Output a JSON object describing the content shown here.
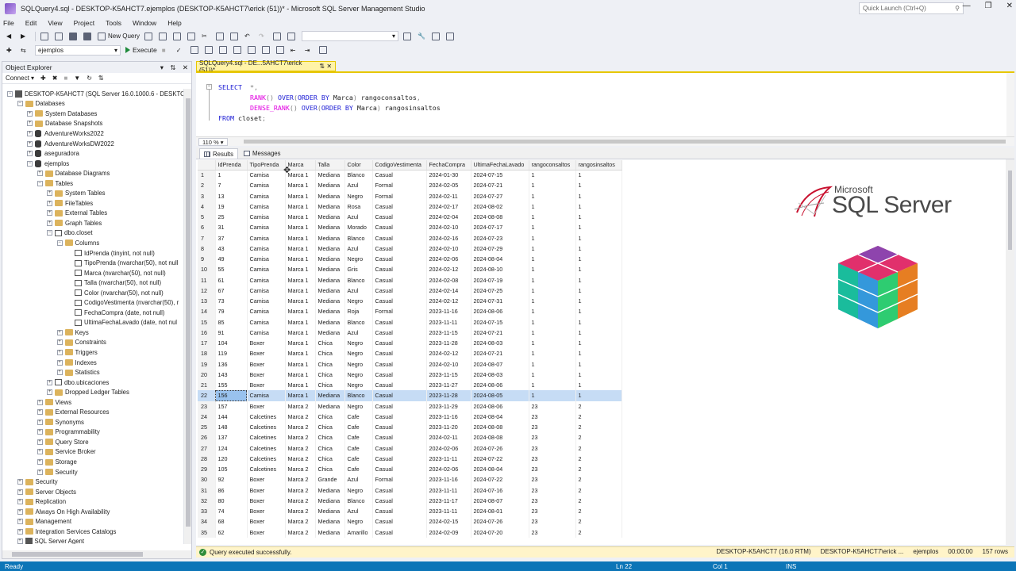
{
  "window": {
    "title": "SQLQuery4.sql - DESKTOP-K5AHCT7.ejemplos (DESKTOP-K5AHCT7\\erick (51))* - Microsoft SQL Server Management Studio",
    "quick_launch_placeholder": "Quick Launch (Ctrl+Q)"
  },
  "menu": [
    "File",
    "Edit",
    "View",
    "Project",
    "Tools",
    "Window",
    "Help"
  ],
  "toolbar": {
    "new_query_label": "New Query",
    "database_selected": "ejemplos",
    "execute_label": "Execute"
  },
  "object_explorer": {
    "title": "Object Explorer",
    "connect_label": "Connect",
    "tree": [
      {
        "depth": 0,
        "exp": "-",
        "icon": "server",
        "label": "DESKTOP-K5AHCT7 (SQL Server 16.0.1000.6 - DESKTOP-"
      },
      {
        "depth": 1,
        "exp": "-",
        "icon": "folder",
        "label": "Databases"
      },
      {
        "depth": 2,
        "exp": "+",
        "icon": "folder",
        "label": "System Databases"
      },
      {
        "depth": 2,
        "exp": "+",
        "icon": "folder",
        "label": "Database Snapshots"
      },
      {
        "depth": 2,
        "exp": "+",
        "icon": "db",
        "label": "AdventureWorks2022"
      },
      {
        "depth": 2,
        "exp": "+",
        "icon": "db",
        "label": "AdventureWorksDW2022"
      },
      {
        "depth": 2,
        "exp": "+",
        "icon": "db",
        "label": "aseguradora"
      },
      {
        "depth": 2,
        "exp": "-",
        "icon": "db",
        "label": "ejemplos"
      },
      {
        "depth": 3,
        "exp": "+",
        "icon": "folder",
        "label": "Database Diagrams"
      },
      {
        "depth": 3,
        "exp": "-",
        "icon": "folder",
        "label": "Tables"
      },
      {
        "depth": 4,
        "exp": "+",
        "icon": "folder",
        "label": "System Tables"
      },
      {
        "depth": 4,
        "exp": "+",
        "icon": "folder",
        "label": "FileTables"
      },
      {
        "depth": 4,
        "exp": "+",
        "icon": "folder",
        "label": "External Tables"
      },
      {
        "depth": 4,
        "exp": "+",
        "icon": "folder",
        "label": "Graph Tables"
      },
      {
        "depth": 4,
        "exp": "-",
        "icon": "table",
        "label": "dbo.closet"
      },
      {
        "depth": 5,
        "exp": "-",
        "icon": "folder",
        "label": "Columns"
      },
      {
        "depth": 6,
        "exp": "",
        "icon": "column",
        "label": "IdPrenda (tinyint, not null)"
      },
      {
        "depth": 6,
        "exp": "",
        "icon": "column",
        "label": "TipoPrenda (nvarchar(50), not null"
      },
      {
        "depth": 6,
        "exp": "",
        "icon": "column",
        "label": "Marca (nvarchar(50), not null)"
      },
      {
        "depth": 6,
        "exp": "",
        "icon": "column",
        "label": "Talla (nvarchar(50), not null)"
      },
      {
        "depth": 6,
        "exp": "",
        "icon": "column",
        "label": "Color (nvarchar(50), not null)"
      },
      {
        "depth": 6,
        "exp": "",
        "icon": "column",
        "label": "CodigoVestimenta (nvarchar(50), r"
      },
      {
        "depth": 6,
        "exp": "",
        "icon": "column",
        "label": "FechaCompra (date, not null)"
      },
      {
        "depth": 6,
        "exp": "",
        "icon": "column",
        "label": "UltimaFechaLavado (date, not nul"
      },
      {
        "depth": 5,
        "exp": "+",
        "icon": "folder",
        "label": "Keys"
      },
      {
        "depth": 5,
        "exp": "+",
        "icon": "folder",
        "label": "Constraints"
      },
      {
        "depth": 5,
        "exp": "+",
        "icon": "folder",
        "label": "Triggers"
      },
      {
        "depth": 5,
        "exp": "+",
        "icon": "folder",
        "label": "Indexes"
      },
      {
        "depth": 5,
        "exp": "+",
        "icon": "folder",
        "label": "Statistics"
      },
      {
        "depth": 4,
        "exp": "+",
        "icon": "table",
        "label": "dbo.ubicaciones"
      },
      {
        "depth": 4,
        "exp": "+",
        "icon": "folder",
        "label": "Dropped Ledger Tables"
      },
      {
        "depth": 3,
        "exp": "+",
        "icon": "folder",
        "label": "Views"
      },
      {
        "depth": 3,
        "exp": "+",
        "icon": "folder",
        "label": "External Resources"
      },
      {
        "depth": 3,
        "exp": "+",
        "icon": "folder",
        "label": "Synonyms"
      },
      {
        "depth": 3,
        "exp": "+",
        "icon": "folder",
        "label": "Programmability"
      },
      {
        "depth": 3,
        "exp": "+",
        "icon": "folder",
        "label": "Query Store"
      },
      {
        "depth": 3,
        "exp": "+",
        "icon": "folder",
        "label": "Service Broker"
      },
      {
        "depth": 3,
        "exp": "+",
        "icon": "folder",
        "label": "Storage"
      },
      {
        "depth": 3,
        "exp": "+",
        "icon": "folder",
        "label": "Security"
      },
      {
        "depth": 1,
        "exp": "+",
        "icon": "folder",
        "label": "Security"
      },
      {
        "depth": 1,
        "exp": "+",
        "icon": "folder",
        "label": "Server Objects"
      },
      {
        "depth": 1,
        "exp": "+",
        "icon": "folder",
        "label": "Replication"
      },
      {
        "depth": 1,
        "exp": "+",
        "icon": "folder",
        "label": "Always On High Availability"
      },
      {
        "depth": 1,
        "exp": "+",
        "icon": "folder",
        "label": "Management"
      },
      {
        "depth": 1,
        "exp": "+",
        "icon": "folder",
        "label": "Integration Services Catalogs"
      },
      {
        "depth": 1,
        "exp": "+",
        "icon": "server",
        "label": "SQL Server Agent"
      }
    ]
  },
  "editor": {
    "tab_label": "SQLQuery4.sql - DE...5AHCT7\\erick (51))*",
    "code": [
      {
        "parts": [
          [
            "kw",
            "SELECT"
          ],
          [
            "gr",
            "  *,"
          ]
        ]
      },
      {
        "parts": [
          [
            "fn",
            "        RANK"
          ],
          [
            "gr",
            "()"
          ],
          [
            "kw",
            " OVER"
          ],
          [
            "gr",
            "("
          ],
          [
            "kw",
            "ORDER BY"
          ],
          [
            "",
            " Marca"
          ],
          [
            "gr",
            ")"
          ],
          [
            "",
            " rangoconsaltos"
          ],
          [
            "gr",
            ","
          ]
        ]
      },
      {
        "parts": [
          [
            "fn",
            "        DENSE_RANK"
          ],
          [
            "gr",
            "()"
          ],
          [
            "kw",
            " OVER"
          ],
          [
            "gr",
            "("
          ],
          [
            "kw",
            "ORDER BY"
          ],
          [
            "",
            " Marca"
          ],
          [
            "gr",
            ")"
          ],
          [
            "",
            " rangosinsaltos"
          ]
        ]
      },
      {
        "parts": [
          [
            "kw",
            "FROM"
          ],
          [
            "",
            " closet"
          ],
          [
            "gr",
            ";"
          ]
        ]
      }
    ],
    "zoom": "110 %"
  },
  "results": {
    "tabs": [
      "Results",
      "Messages"
    ],
    "columns": [
      "IdPrenda",
      "TipoPrenda",
      "Marca",
      "Talla",
      "Color",
      "CodigoVestimenta",
      "FechaCompra",
      "UltimaFechaLavado",
      "rangoconsaltos",
      "rangosinsaltos"
    ],
    "selected_row": 22,
    "rows": [
      [
        "1",
        "1",
        "Camisa",
        "Marca 1",
        "Mediana",
        "Blanco",
        "Casual",
        "2024-01-30",
        "2024-07-15",
        "1",
        "1"
      ],
      [
        "2",
        "7",
        "Camisa",
        "Marca 1",
        "Mediana",
        "Azul",
        "Formal",
        "2024-02-05",
        "2024-07-21",
        "1",
        "1"
      ],
      [
        "3",
        "13",
        "Camisa",
        "Marca 1",
        "Mediana",
        "Negro",
        "Formal",
        "2024-02-11",
        "2024-07-27",
        "1",
        "1"
      ],
      [
        "4",
        "19",
        "Camisa",
        "Marca 1",
        "Mediana",
        "Rosa",
        "Casual",
        "2024-02-17",
        "2024-08-02",
        "1",
        "1"
      ],
      [
        "5",
        "25",
        "Camisa",
        "Marca 1",
        "Mediana",
        "Azul",
        "Casual",
        "2024-02-04",
        "2024-08-08",
        "1",
        "1"
      ],
      [
        "6",
        "31",
        "Camisa",
        "Marca 1",
        "Mediana",
        "Morado",
        "Casual",
        "2024-02-10",
        "2024-07-17",
        "1",
        "1"
      ],
      [
        "7",
        "37",
        "Camisa",
        "Marca 1",
        "Mediana",
        "Blanco",
        "Casual",
        "2024-02-16",
        "2024-07-23",
        "1",
        "1"
      ],
      [
        "8",
        "43",
        "Camisa",
        "Marca 1",
        "Mediana",
        "Azul",
        "Casual",
        "2024-02-10",
        "2024-07-29",
        "1",
        "1"
      ],
      [
        "9",
        "49",
        "Camisa",
        "Marca 1",
        "Mediana",
        "Negro",
        "Casual",
        "2024-02-06",
        "2024-08-04",
        "1",
        "1"
      ],
      [
        "10",
        "55",
        "Camisa",
        "Marca 1",
        "Mediana",
        "Gris",
        "Casual",
        "2024-02-12",
        "2024-08-10",
        "1",
        "1"
      ],
      [
        "11",
        "61",
        "Camisa",
        "Marca 1",
        "Mediana",
        "Blanco",
        "Casual",
        "2024-02-08",
        "2024-07-19",
        "1",
        "1"
      ],
      [
        "12",
        "67",
        "Camisa",
        "Marca 1",
        "Mediana",
        "Azul",
        "Casual",
        "2024-02-14",
        "2024-07-25",
        "1",
        "1"
      ],
      [
        "13",
        "73",
        "Camisa",
        "Marca 1",
        "Mediana",
        "Negro",
        "Casual",
        "2024-02-12",
        "2024-07-31",
        "1",
        "1"
      ],
      [
        "14",
        "79",
        "Camisa",
        "Marca 1",
        "Mediana",
        "Roja",
        "Formal",
        "2023-11-16",
        "2024-08-06",
        "1",
        "1"
      ],
      [
        "15",
        "85",
        "Camisa",
        "Marca 1",
        "Mediana",
        "Blanco",
        "Casual",
        "2023-11-11",
        "2024-07-15",
        "1",
        "1"
      ],
      [
        "16",
        "91",
        "Camisa",
        "Marca 1",
        "Mediana",
        "Azul",
        "Casual",
        "2023-11-15",
        "2024-07-21",
        "1",
        "1"
      ],
      [
        "17",
        "104",
        "Boxer",
        "Marca 1",
        "Chica",
        "Negro",
        "Casual",
        "2023-11-28",
        "2024-08-03",
        "1",
        "1"
      ],
      [
        "18",
        "119",
        "Boxer",
        "Marca 1",
        "Chica",
        "Negro",
        "Casual",
        "2024-02-12",
        "2024-07-21",
        "1",
        "1"
      ],
      [
        "19",
        "136",
        "Boxer",
        "Marca 1",
        "Chica",
        "Negro",
        "Casual",
        "2024-02-10",
        "2024-08-07",
        "1",
        "1"
      ],
      [
        "20",
        "143",
        "Boxer",
        "Marca 1",
        "Chica",
        "Negro",
        "Casual",
        "2023-11-15",
        "2024-08-03",
        "1",
        "1"
      ],
      [
        "21",
        "155",
        "Boxer",
        "Marca 1",
        "Chica",
        "Negro",
        "Casual",
        "2023-11-27",
        "2024-08-06",
        "1",
        "1"
      ],
      [
        "22",
        "156",
        "Camisa",
        "Marca 1",
        "Mediana",
        "Blanco",
        "Casual",
        "2023-11-28",
        "2024-08-05",
        "1",
        "1"
      ],
      [
        "23",
        "157",
        "Boxer",
        "Marca 2",
        "Mediana",
        "Negro",
        "Casual",
        "2023-11-29",
        "2024-08-06",
        "23",
        "2"
      ],
      [
        "24",
        "144",
        "Calcetines",
        "Marca 2",
        "Chica",
        "Cafe",
        "Casual",
        "2023-11-16",
        "2024-08-04",
        "23",
        "2"
      ],
      [
        "25",
        "148",
        "Calcetines",
        "Marca 2",
        "Chica",
        "Cafe",
        "Casual",
        "2023-11-20",
        "2024-08-08",
        "23",
        "2"
      ],
      [
        "26",
        "137",
        "Calcetines",
        "Marca 2",
        "Chica",
        "Cafe",
        "Casual",
        "2024-02-11",
        "2024-08-08",
        "23",
        "2"
      ],
      [
        "27",
        "124",
        "Calcetines",
        "Marca 2",
        "Chica",
        "Cafe",
        "Casual",
        "2024-02-06",
        "2024-07-26",
        "23",
        "2"
      ],
      [
        "28",
        "120",
        "Calcetines",
        "Marca 2",
        "Chica",
        "Cafe",
        "Casual",
        "2023-11-11",
        "2024-07-22",
        "23",
        "2"
      ],
      [
        "29",
        "105",
        "Calcetines",
        "Marca 2",
        "Chica",
        "Cafe",
        "Casual",
        "2024-02-06",
        "2024-08-04",
        "23",
        "2"
      ],
      [
        "30",
        "92",
        "Boxer",
        "Marca 2",
        "Grande",
        "Azul",
        "Formal",
        "2023-11-16",
        "2024-07-22",
        "23",
        "2"
      ],
      [
        "31",
        "86",
        "Boxer",
        "Marca 2",
        "Mediana",
        "Negro",
        "Casual",
        "2023-11-11",
        "2024-07-16",
        "23",
        "2"
      ],
      [
        "32",
        "80",
        "Boxer",
        "Marca 2",
        "Mediana",
        "Blanco",
        "Casual",
        "2023-11-17",
        "2024-08-07",
        "23",
        "2"
      ],
      [
        "33",
        "74",
        "Boxer",
        "Marca 2",
        "Mediana",
        "Azul",
        "Casual",
        "2023-11-11",
        "2024-08-01",
        "23",
        "2"
      ],
      [
        "34",
        "68",
        "Boxer",
        "Marca 2",
        "Mediana",
        "Negro",
        "Casual",
        "2024-02-15",
        "2024-07-26",
        "23",
        "2"
      ],
      [
        "35",
        "62",
        "Boxer",
        "Marca 2",
        "Mediana",
        "Amarillo",
        "Casual",
        "2024-02-09",
        "2024-07-20",
        "23",
        "2"
      ]
    ]
  },
  "logo": {
    "microsoft_text": "Microsoft",
    "product_text": "SQL Server"
  },
  "query_status": {
    "message": "Query executed successfully.",
    "server": "DESKTOP-K5AHCT7 (16.0 RTM)",
    "user": "DESKTOP-K5AHCT7\\erick ...",
    "database": "ejemplos",
    "elapsed": "00:00:00",
    "rows": "157 rows"
  },
  "statusbar": {
    "ready": "Ready",
    "line": "Ln 22",
    "col": "Col 1",
    "mode": "INS"
  },
  "colors": {
    "statusbar_blue": "#0c75b7",
    "tab_yellow": "#fff3a7",
    "selection_blue": "#c6dcf5"
  }
}
